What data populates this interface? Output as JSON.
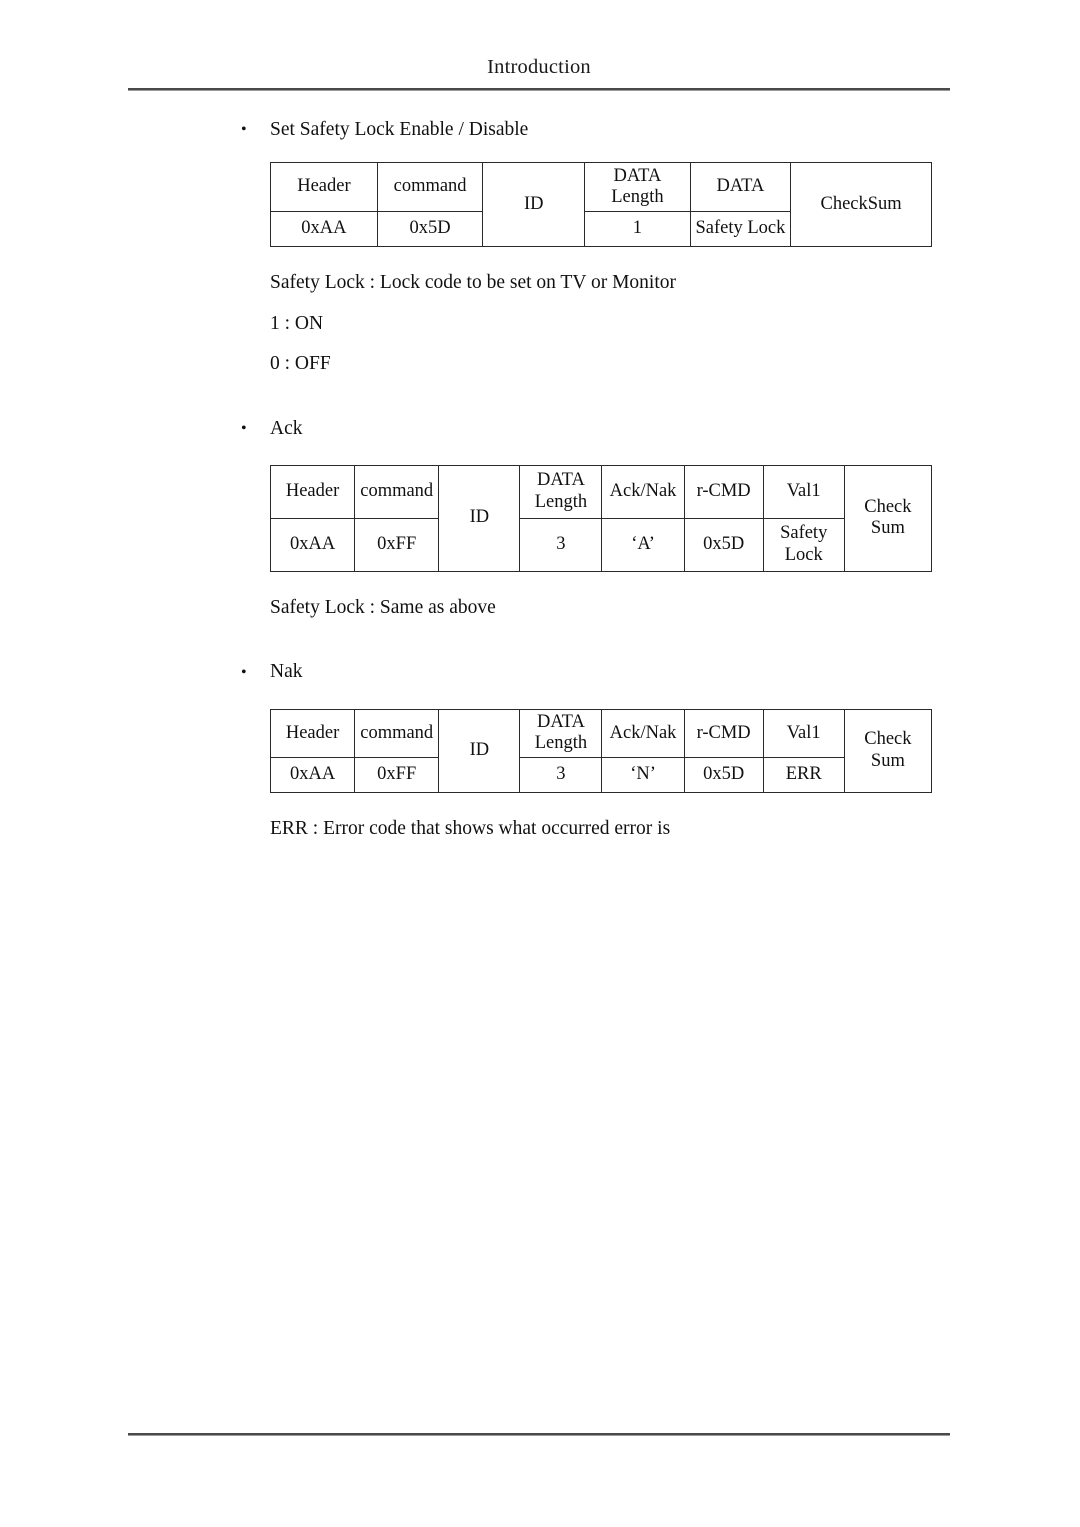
{
  "header": {
    "title": "Introduction"
  },
  "sections": {
    "set_safety_lock": {
      "bullet": "•",
      "label": "Set Safety Lock Enable / Disable",
      "table": {
        "header_row": [
          "Header",
          "command",
          "ID",
          "DATA\nLength",
          "DATA",
          "CheckSum"
        ],
        "value_row": [
          "0xAA",
          "0x5D",
          "1",
          "Safety Lock"
        ]
      },
      "notes": [
        "Safety Lock : Lock code to be set on TV or Monitor",
        "1 : ON",
        "0 : OFF"
      ]
    },
    "ack": {
      "bullet": "•",
      "label": "Ack",
      "table": {
        "header_row": [
          "Header",
          "command",
          "ID",
          "DATA\nLength",
          "Ack/Nak",
          "r-CMD",
          "Val1",
          "Check\nSum"
        ],
        "value_row": [
          "0xAA",
          "0xFF",
          "3",
          "‘A’",
          "0x5D",
          "Safety\nLock"
        ]
      },
      "notes": [
        "Safety Lock : Same as above"
      ]
    },
    "nak": {
      "bullet": "•",
      "label": "Nak",
      "table": {
        "header_row": [
          "Header",
          "command",
          "ID",
          "DATA\nLength",
          "Ack/Nak",
          "r-CMD",
          "Val1",
          "Check\nSum"
        ],
        "value_row": [
          "0xAA",
          "0xFF",
          "3",
          "‘N’",
          "0x5D",
          "ERR"
        ]
      },
      "notes": [
        "ERR : Error code that shows what occurred error is"
      ]
    }
  }
}
